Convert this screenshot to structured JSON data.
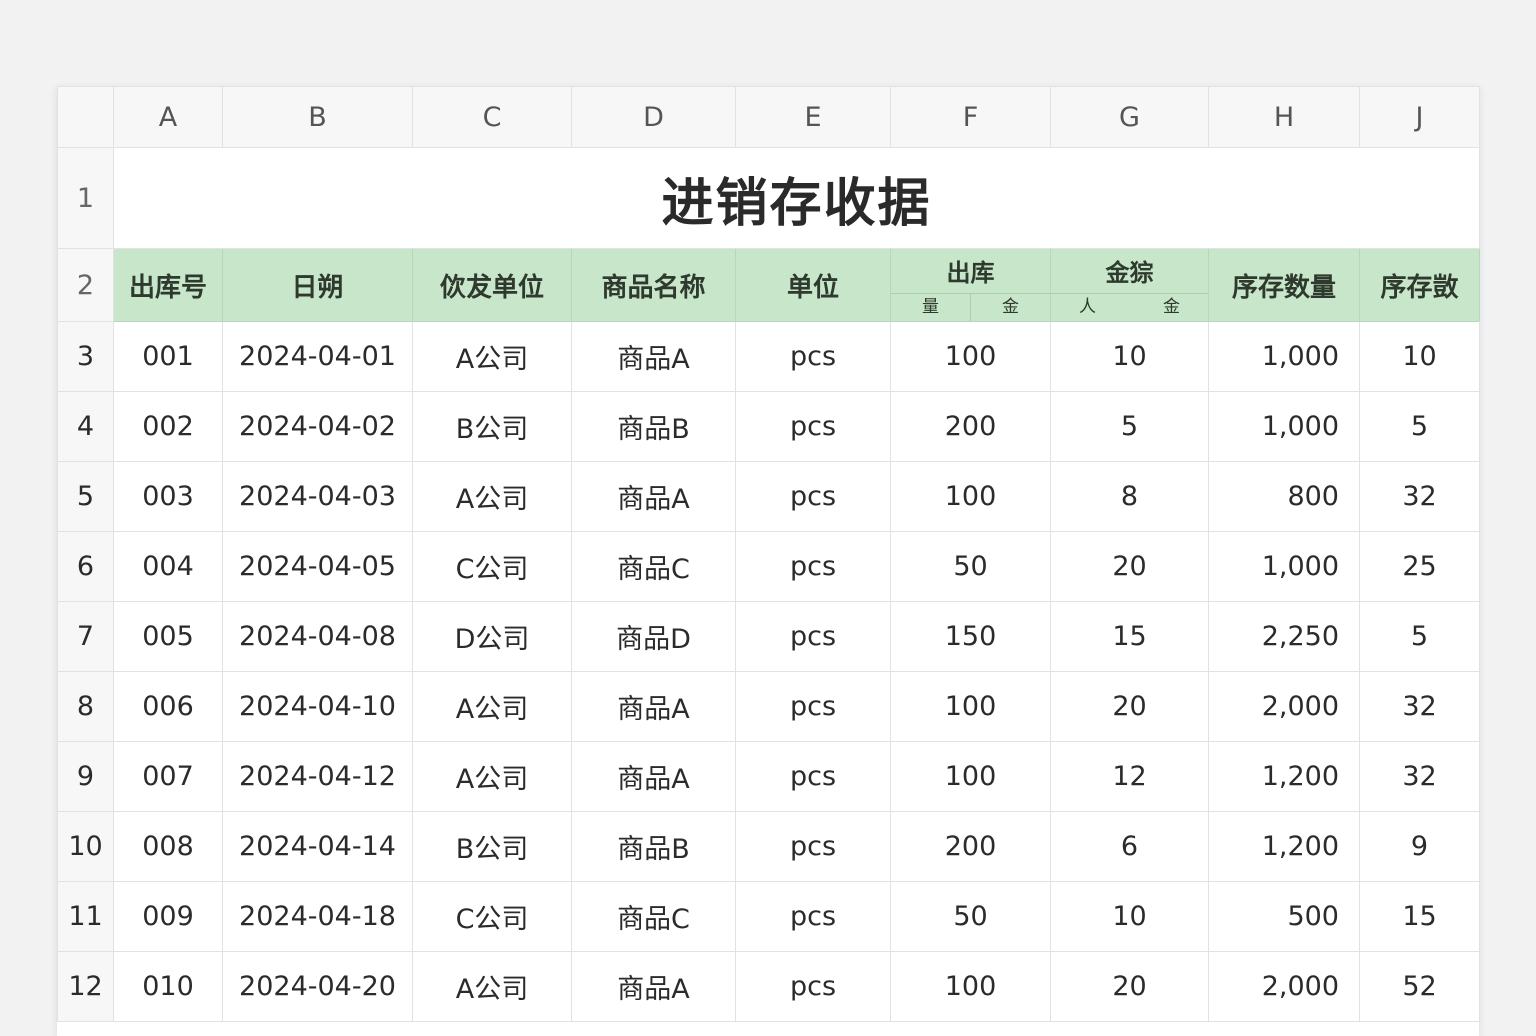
{
  "columns": [
    "A",
    "B",
    "C",
    "D",
    "E",
    "F",
    "G",
    "H",
    "J"
  ],
  "row_numbers": [
    "1",
    "2",
    "3",
    "4",
    "5",
    "6",
    "7",
    "8",
    "9",
    "10",
    "11",
    "12"
  ],
  "title": "进销存收据",
  "headers": {
    "a": "出库号",
    "b": "日朔",
    "c": "佽犮单位",
    "d": "商品名称",
    "e": "单位",
    "f": "出库",
    "f_sub_1": "量",
    "f_sub_2": "金",
    "g": "金猔",
    "g_sub_1": "人",
    "g_sub_2": "金",
    "h": "序存数量",
    "j": "序存敳"
  },
  "rows": [
    {
      "no": "001",
      "date": "2024-04-01",
      "company": "A公司",
      "product": "商品A",
      "unit": "pcs",
      "qty": "100",
      "price": "10",
      "amount": "1,000",
      "stock_qty": "10",
      "stock": "10"
    },
    {
      "no": "002",
      "date": "2024-04-02",
      "company": "B公司",
      "product": "商品B",
      "unit": "pcs",
      "qty": "200",
      "price": "5",
      "amount": "1,000",
      "stock_qty": "5",
      "stock": "5"
    },
    {
      "no": "003",
      "date": "2024-04-03",
      "company": "A公司",
      "product": "商品A",
      "unit": "pcs",
      "qty": "100",
      "price": "8",
      "amount": "800",
      "stock_qty": "32",
      "stock": "32"
    },
    {
      "no": "004",
      "date": "2024-04-05",
      "company": "C公司",
      "product": "商品C",
      "unit": "pcs",
      "qty": "50",
      "price": "20",
      "amount": "1,000",
      "stock_qty": "25",
      "stock": "25"
    },
    {
      "no": "005",
      "date": "2024-04-08",
      "company": "D公司",
      "product": "商品D",
      "unit": "pcs",
      "qty": "150",
      "price": "15",
      "amount": "2,250",
      "stock_qty": "5",
      "stock": "5"
    },
    {
      "no": "006",
      "date": "2024-04-10",
      "company": "A公司",
      "product": "商品A",
      "unit": "pcs",
      "qty": "100",
      "price": "20",
      "amount": "2,000",
      "stock_qty": "32",
      "stock": "32"
    },
    {
      "no": "007",
      "date": "2024-04-12",
      "company": "A公司",
      "product": "商品A",
      "unit": "pcs",
      "qty": "100",
      "price": "12",
      "amount": "1,200",
      "stock_qty": "32",
      "stock": "32"
    },
    {
      "no": "008",
      "date": "2024-04-14",
      "company": "B公司",
      "product": "商品B",
      "unit": "pcs",
      "qty": "200",
      "price": "6",
      "amount": "1,200",
      "stock_qty": "9",
      "stock": "9"
    },
    {
      "no": "009",
      "date": "2024-04-18",
      "company": "C公司",
      "product": "商品C",
      "unit": "pcs",
      "qty": "50",
      "price": "10",
      "amount": "500",
      "stock_qty": "15",
      "stock": "15"
    },
    {
      "no": "010",
      "date": "2024-04-20",
      "company": "A公司",
      "product": "商品A",
      "unit": "pcs",
      "qty": "100",
      "price": "20",
      "amount": "2,000",
      "stock_qty": "52",
      "stock": "52"
    }
  ],
  "colors": {
    "header_green": "#c8e6c9",
    "background": "#f2f2f3",
    "grid_line": "#e2e2e2"
  }
}
